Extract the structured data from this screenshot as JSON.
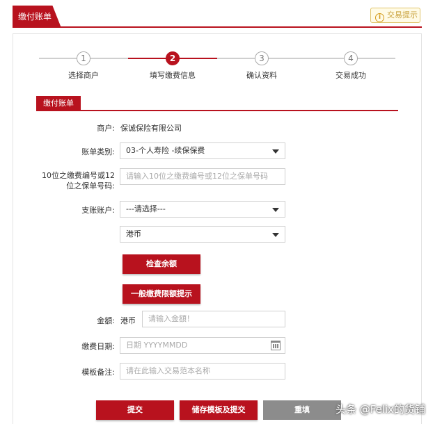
{
  "header": {
    "tab_label": "缴付账单",
    "tip_label": "交易提示"
  },
  "steps": [
    {
      "num": "1",
      "label": "选择商户"
    },
    {
      "num": "2",
      "label": "填写缴费信息"
    },
    {
      "num": "3",
      "label": "确认资料"
    },
    {
      "num": "4",
      "label": "交易成功"
    }
  ],
  "active_step": 2,
  "section": {
    "title": "缴付账单"
  },
  "form": {
    "merchant": {
      "label": "商户:",
      "value": "保诚保险有限公司"
    },
    "bill_type": {
      "label": "账单类别:",
      "value": "03-个人寿险 -续保保费"
    },
    "policy_no": {
      "label_line1": "10位之缴费编号或12",
      "label_line2": "位之保单号码:",
      "placeholder": "请输入10位之缴费编号或12位之保单号码"
    },
    "account": {
      "label": "支账账户:",
      "value": "---请选择---"
    },
    "currency": {
      "value": "港币"
    },
    "check_balance_label": "检查余额",
    "limit_tip_label": "一般缴费限额提示",
    "amount": {
      "label": "金額:",
      "currency": "港币",
      "placeholder": "请输入金額！"
    },
    "date": {
      "label": "缴费日期:",
      "placeholder": "日期 YYYYMMDD"
    },
    "remark": {
      "label": "模板备注:",
      "placeholder": "请在此输入交易范本名称"
    }
  },
  "actions": {
    "submit": "提交",
    "save_submit": "储存模板及提交",
    "reset": "重填"
  },
  "watermark": "头条 @Felix的货铺",
  "colors": {
    "brand": "#b8121e",
    "tip": "#d49a18",
    "reset": "#8c8c8c"
  }
}
